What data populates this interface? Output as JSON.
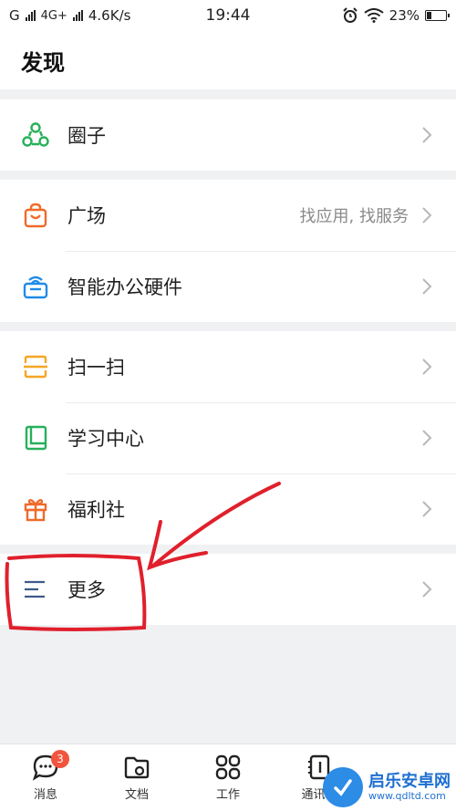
{
  "status_bar": {
    "carrier": "G",
    "network": "4G+",
    "speed": "4.6K/s",
    "time": "19:44",
    "battery": "23%",
    "battery_level": 0.23
  },
  "header": {
    "title": "发现"
  },
  "groups": [
    [
      {
        "label": "圈子",
        "icon": "circle-group-icon",
        "color": "#27b05a"
      }
    ],
    [
      {
        "label": "广场",
        "sub": "找应用, 找服务",
        "icon": "shopping-bag-icon",
        "color": "#f06a2b"
      },
      {
        "label": "智能办公硬件",
        "icon": "office-hardware-icon",
        "color": "#1f8be8"
      }
    ],
    [
      {
        "label": "扫一扫",
        "icon": "scan-icon",
        "color": "#f5a623"
      },
      {
        "label": "学习中心",
        "icon": "book-icon",
        "color": "#27b05a"
      },
      {
        "label": "福利社",
        "icon": "gift-icon",
        "color": "#f06a2b"
      }
    ],
    [
      {
        "label": "更多",
        "icon": "menu-icon",
        "color": "#3d5a8a"
      }
    ]
  ],
  "tabbar": {
    "items": [
      {
        "label": "消息",
        "icon": "message-icon",
        "badge": "3"
      },
      {
        "label": "文档",
        "icon": "document-folder-icon"
      },
      {
        "label": "工作",
        "icon": "workbench-grid-icon"
      },
      {
        "label": "通讯录",
        "icon": "contacts-icon"
      }
    ]
  },
  "watermark": {
    "title": "启乐安卓网",
    "url": "www.qdltd.com"
  }
}
